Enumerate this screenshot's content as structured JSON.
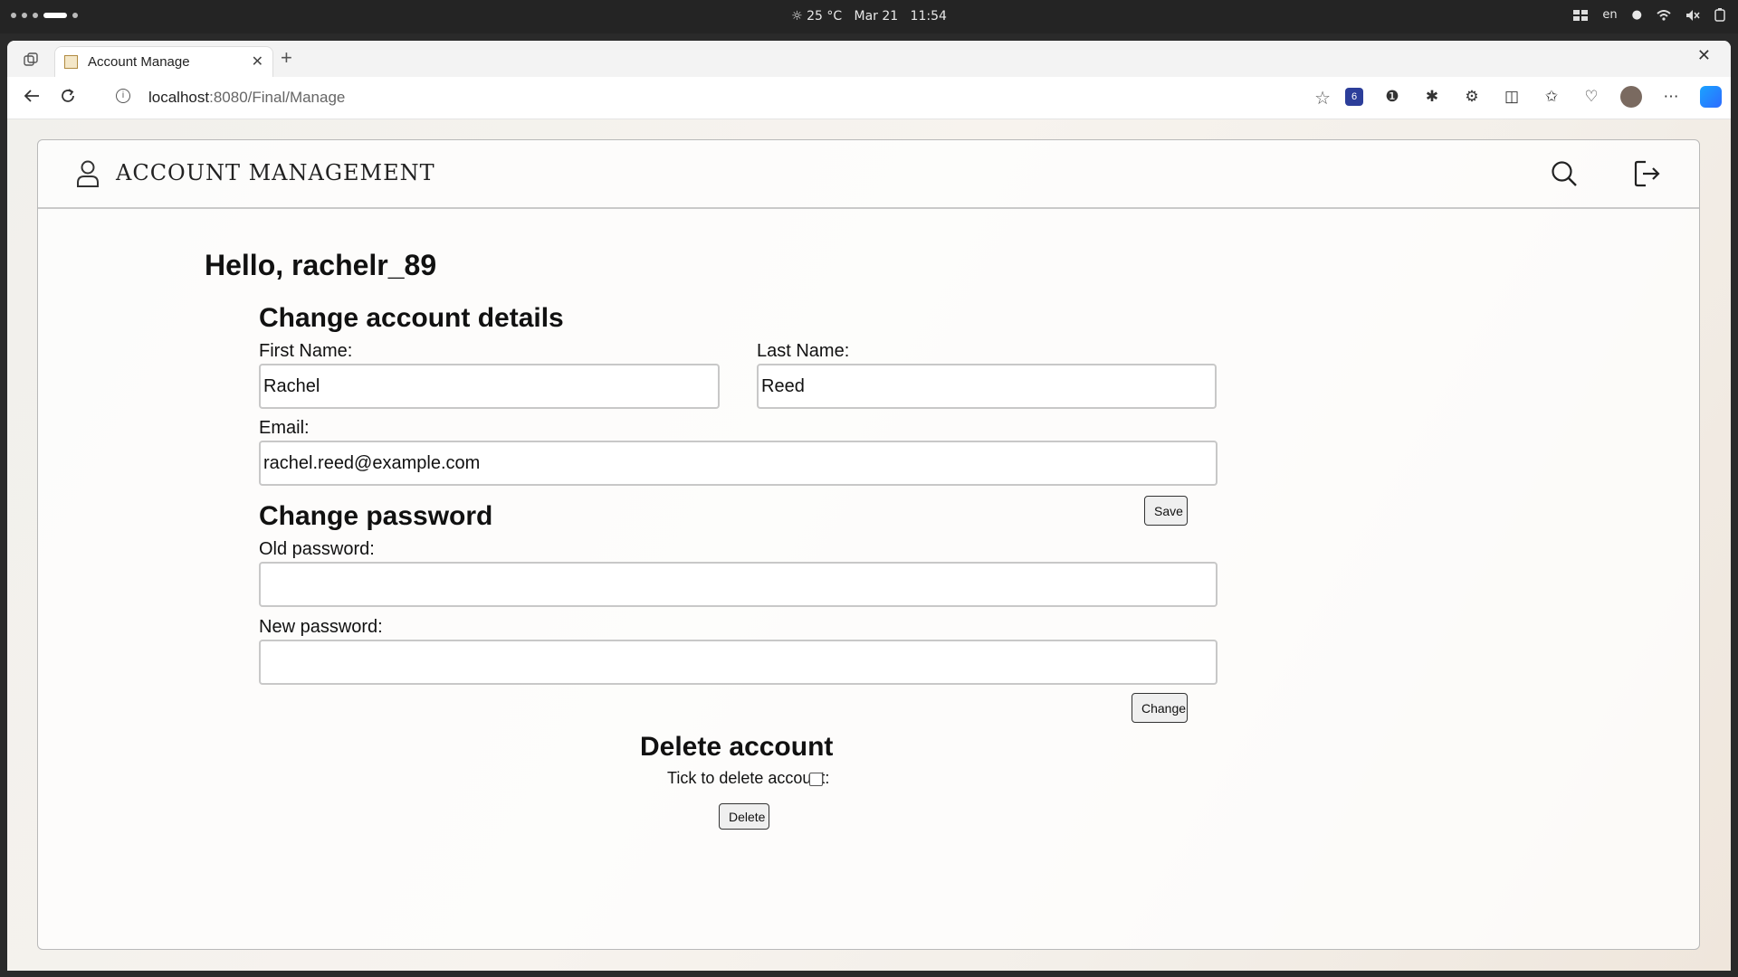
{
  "system_bar": {
    "weather": "25 °C",
    "date": "Mar 21",
    "time": "11:54",
    "language": "en"
  },
  "browser": {
    "tab_title": "Account Manage",
    "url_host": "localhost",
    "url_rest": ":8080/Final/Manage",
    "extension_badge": "6"
  },
  "app": {
    "brand": "ACCOUNT MANAGEMENT",
    "greeting": "Hello, rachelr_89",
    "details": {
      "title": "Change account details",
      "first_name_label": "First Name:",
      "first_name_value": "Rachel",
      "last_name_label": "Last Name:",
      "last_name_value": "Reed",
      "email_label": "Email:",
      "email_value": "rachel.reed@example.com",
      "save_label": "Save"
    },
    "password": {
      "title": "Change password",
      "old_label": "Old password:",
      "old_value": "",
      "new_label": "New password:",
      "new_value": "",
      "change_label": "Change"
    },
    "delete": {
      "title": "Delete account",
      "tick_label": "Tick to delete account:",
      "delete_label": "Delete"
    }
  }
}
